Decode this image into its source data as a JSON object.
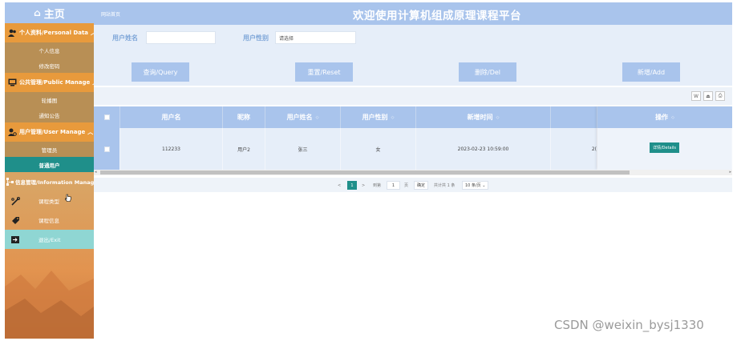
{
  "sidebar": {
    "home": "主页",
    "groups": [
      {
        "label": "个人资料/Personal Data",
        "items": [
          "个人信息",
          "修改密码"
        ]
      },
      {
        "label": "公共管理/Public Manage",
        "items": [
          "轮播图",
          "通知公告"
        ]
      },
      {
        "label": "用户管理/User Manage",
        "items": [
          "管理员",
          "普通用户"
        ]
      }
    ],
    "info_manage": "信息管理/Information Manage",
    "course_type": "课程类型",
    "course_info": "课程信息",
    "exit": "退出/Exit"
  },
  "header": {
    "breadcrumb": "网站首页",
    "title": "欢迎使用计算机组成原理课程平台"
  },
  "search": {
    "username_label": "用户姓名",
    "username_value": "",
    "gender_label": "用户性别",
    "gender_placeholder": "请选择"
  },
  "buttons": {
    "query": "查询/Query",
    "reset": "重置/Reset",
    "delete": "删除/Del",
    "add": "新增/Add"
  },
  "tools": {
    "word": "W",
    "export": "⏏",
    "print": "⎙"
  },
  "table": {
    "headers": [
      "用户名",
      "昵称",
      "用户姓名",
      "用户性别",
      "新增时间",
      "操作"
    ],
    "rows": [
      {
        "username": "112233",
        "nickname": "用户2",
        "realname": "张三",
        "gender": "女",
        "created": "2023-02-23 10:59:00",
        "cut": "2(",
        "action": "详情/Details"
      }
    ]
  },
  "pager": {
    "prev": "<",
    "current": "1",
    "next": ">",
    "goto_label": "到第",
    "goto_value": "1",
    "page_unit": "页",
    "confirm": "确定",
    "total": "共计共 1 条",
    "page_size": "10 条/页"
  },
  "watermark": "CSDN @weixin_bysj1330",
  "colors": {
    "header": "#a9c4ec",
    "sidebar_group": "#e89a3c",
    "accent": "#1f8f8a",
    "panel": "#e6eef9"
  }
}
